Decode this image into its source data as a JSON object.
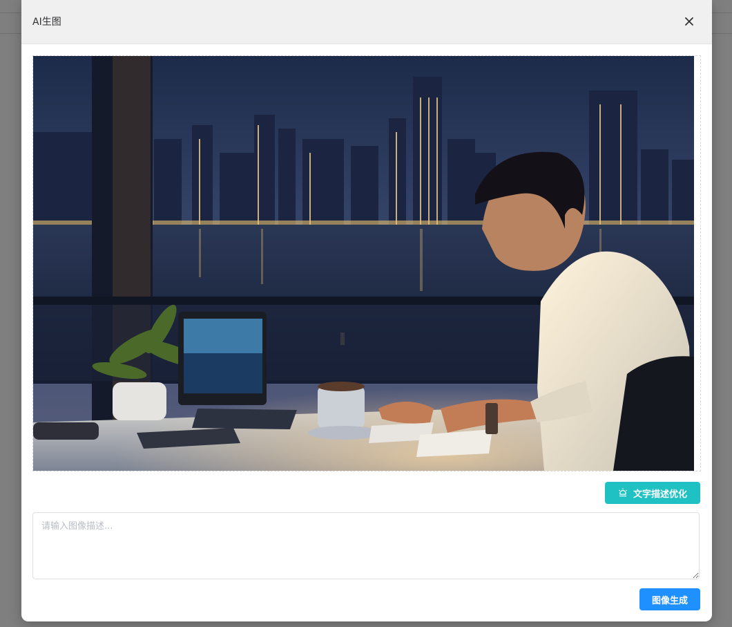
{
  "dialog": {
    "title": "AI生图",
    "close_icon": "close-icon"
  },
  "preview": {
    "description": "generated-image-preview"
  },
  "toolbar": {
    "optimize_label": "文字描述优化",
    "optimize_icon": "lightbulb-icon"
  },
  "prompt": {
    "placeholder": "请输入图像描述...",
    "value": ""
  },
  "actions": {
    "generate_label": "图像生成"
  },
  "colors": {
    "optimize_button": "#1fc1c3",
    "generate_button": "#1e90ff",
    "header_bg": "#f0f0f0"
  }
}
